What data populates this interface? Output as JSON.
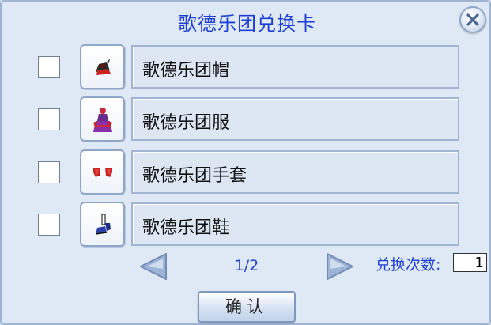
{
  "dialog": {
    "title": "歌德乐团兑换卡",
    "items": [
      {
        "name": "歌德乐团帽",
        "icon": "goth-hat-icon",
        "checked": false
      },
      {
        "name": "歌德乐团服",
        "icon": "goth-dress-icon",
        "checked": false
      },
      {
        "name": "歌德乐团手套",
        "icon": "goth-gloves-icon",
        "checked": false
      },
      {
        "name": "歌德乐团鞋",
        "icon": "goth-shoes-icon",
        "checked": false
      }
    ],
    "pagination": {
      "text": "1/2"
    },
    "exchange_count": {
      "label": "兑换次数:",
      "value": "1"
    },
    "confirm_label": "确认"
  },
  "colors": {
    "title": "#1d3fd6",
    "panel": "#dfe9f5",
    "accent_arrow": "#9db4d6"
  }
}
